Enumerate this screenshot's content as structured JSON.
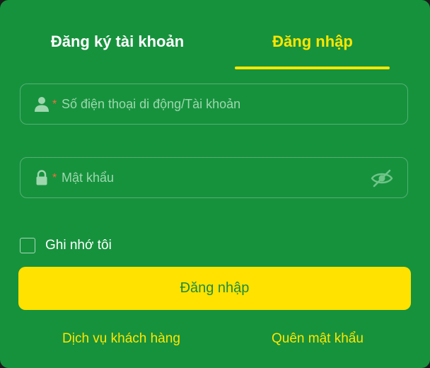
{
  "tabs": {
    "register_label": "Đăng ký tài khoản",
    "login_label": "Đăng nhập",
    "active": "login"
  },
  "form": {
    "phone": {
      "placeholder": "Số điện thoại di động/Tài khoản",
      "value": "",
      "required_mark": "*",
      "icon": "user-icon"
    },
    "password": {
      "placeholder": "Mật khẩu",
      "value": "",
      "required_mark": "*",
      "icon": "lock-icon",
      "toggle_icon": "eye-slash-icon"
    },
    "remember_label": "Ghi nhớ tôi",
    "remember_checked": false,
    "submit_label": "Đăng nhập"
  },
  "links": {
    "support_label": "Dịch vụ khách hàng",
    "forgot_label": "Quên mật khẩu"
  },
  "colors": {
    "background": "#16923d",
    "accent": "#ffe600",
    "text": "#ffffff",
    "required": "#ff6a3a"
  }
}
